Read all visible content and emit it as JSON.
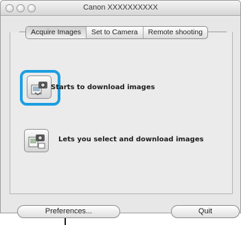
{
  "window": {
    "title": "Canon XXXXXXXXXX"
  },
  "tabs": [
    {
      "label": "Acquire Images",
      "active": true
    },
    {
      "label": "Set to Camera",
      "active": false
    },
    {
      "label": "Remote shooting",
      "active": false
    }
  ],
  "actions": [
    {
      "icon": "camera-download-icon",
      "label": "Starts to download images",
      "highlighted": true,
      "highlight_color": "#1c9ee2"
    },
    {
      "icon": "image-select-icon",
      "label": "Lets you select and download images",
      "highlighted": false
    }
  ],
  "footer": {
    "preferences_label": "Preferences...",
    "quit_label": "Quit"
  }
}
